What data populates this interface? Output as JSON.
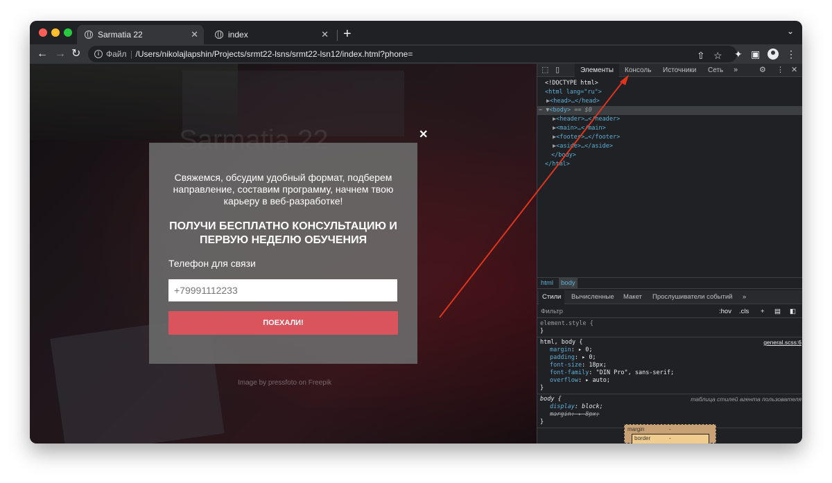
{
  "browser": {
    "tabs": [
      {
        "title": "Sarmatia 22",
        "active": true
      },
      {
        "title": "index",
        "active": false
      }
    ],
    "address": {
      "scheme_label": "Файл",
      "url": "/Users/nikolajlapshin/Projects/srmt22-lsns/srmt22-lsn12/index.html?phone="
    }
  },
  "page": {
    "bg_title": "Sarmatia 22",
    "modal": {
      "text": "Свяжемся, обсудим удобный формат, подберем направление, составим программу, начнем твою карьеру в веб-разработке!",
      "heading": "ПОЛУЧИ БЕСПЛАТНО КОНСУЛЬТАЦИЮ И ПЕРВУЮ НЕДЕЛЮ ОБУЧЕНИЯ",
      "phone_label": "Телефон для связи",
      "phone_placeholder": "+79991112233",
      "submit_label": "ПОЕХАЛИ!"
    },
    "credit": "Image by pressfoto on Freepik"
  },
  "devtools": {
    "tabs": [
      "Элементы",
      "Консоль",
      "Источники",
      "Сеть"
    ],
    "active_tab": "Элементы",
    "dom": {
      "doctype": "<!DOCTYPE html>",
      "html_open": "<html lang=\"ru\">",
      "head": "<head>…</head>",
      "body_open": "<body>",
      "body_eq": "== $0",
      "children": [
        "<header>…</header>",
        "<main>…</main>",
        "<footer>…</footer>",
        "<aside>…</aside>"
      ],
      "body_close": "</body>",
      "html_close": "</html>"
    },
    "breadcrumbs": [
      "html",
      "body"
    ],
    "sub_tabs": [
      "Стили",
      "Вычисленные",
      "Макет",
      "Прослушиватели событий"
    ],
    "filter_placeholder": "Фильтр",
    "filter_hov": ":hov",
    "filter_cls": ".cls",
    "styles": {
      "element_style": "element.style {",
      "rule1_selector": "html, body {",
      "rule1_source": "general.scss:6",
      "rule1_props": [
        {
          "name": "margin",
          "value": "0;"
        },
        {
          "name": "padding",
          "value": "0;"
        },
        {
          "name": "font-size",
          "value": "18px;"
        },
        {
          "name": "font-family",
          "value": "\"DIN Pro\", sans-serif;"
        },
        {
          "name": "overflow",
          "value": "auto;"
        }
      ],
      "rule2_selector": "body {",
      "rule2_source": "таблица стилей агента пользователя",
      "rule2_props": [
        {
          "name": "display",
          "value": "block;"
        },
        {
          "name": "margin",
          "value": "8px;"
        }
      ],
      "close_brace": "}"
    },
    "box_model": {
      "margin_label": "margin",
      "border_label": "border",
      "dash": "-"
    }
  },
  "colors": {
    "accent_button": "#d9545c",
    "annotation_arrow": "#e0341e"
  }
}
